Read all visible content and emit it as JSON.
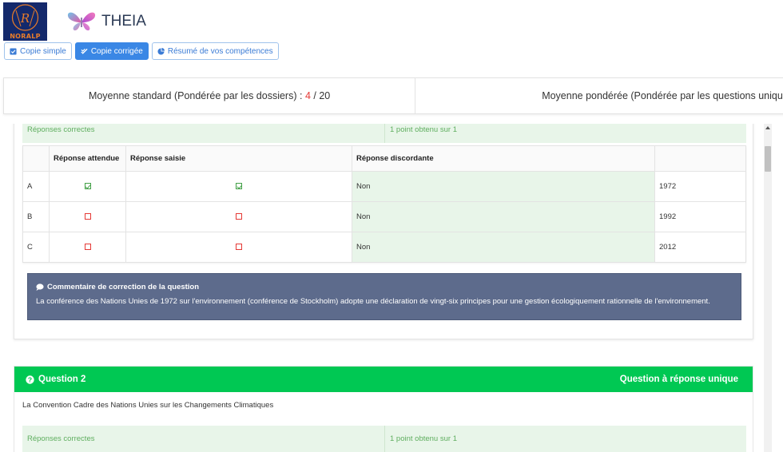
{
  "header": {
    "org_logo_text": "NORALP",
    "app_title": "THEIA"
  },
  "toolbar": {
    "buttons": [
      {
        "label": "Copie simple",
        "icon": "checkbox-icon",
        "active": false
      },
      {
        "label": "Copie corrigée",
        "icon": "check-icon",
        "active": true
      },
      {
        "label": "Résumé de vos compétences",
        "icon": "pie-chart-icon",
        "active": false
      }
    ]
  },
  "averages": {
    "standard_label": "Moyenne standard (Pondérée par les dossiers) :",
    "standard_score": "4",
    "standard_total": "/ 20",
    "weighted_label": "Moyenne pondérée (Pondérée par les questions uniques"
  },
  "question1": {
    "correct_label": "Réponses correctes",
    "points": "1 point obtenu sur 1",
    "table": {
      "headers": [
        "",
        "Réponse attendue",
        "Réponse saisie",
        "Réponse discordante",
        ""
      ],
      "rows": [
        {
          "letter": "A",
          "expected": true,
          "entered": true,
          "discordant": "Non",
          "value": "1972"
        },
        {
          "letter": "B",
          "expected": false,
          "entered": false,
          "discordant": "Non",
          "value": "1992"
        },
        {
          "letter": "C",
          "expected": false,
          "entered": false,
          "discordant": "Non",
          "value": "2012"
        }
      ]
    },
    "comment_title": "Commentaire de correction de la question",
    "comment_text": "La conférence des Nations Unies de 1972 sur l'environnement (conférence de Stockholm) adopte une déclaration de vingt-six principes  pour une gestion écologiquement rationnelle de l'environnement."
  },
  "question2": {
    "title": "Question 2",
    "type": "Question à réponse unique",
    "text": "La Convention Cadre des Nations Unies sur les Changements Climatiques",
    "correct_label": "Réponses correctes",
    "points": "1 point obtenu sur 1"
  },
  "colors": {
    "primary": "#3a87e5",
    "success": "#00c853",
    "comment_bg": "#5d6b8c",
    "score_red": "#e53935"
  }
}
